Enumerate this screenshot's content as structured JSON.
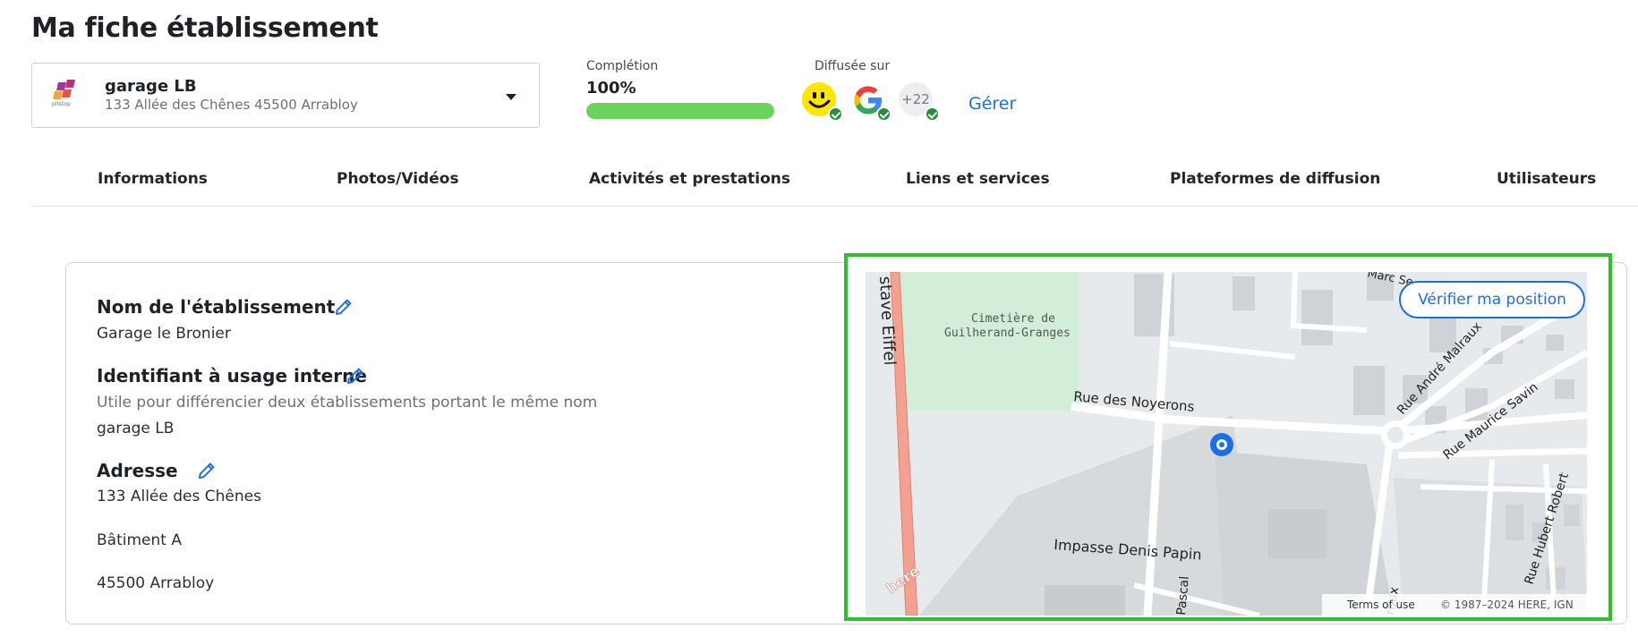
{
  "page": {
    "title": "Ma fiche établissement"
  },
  "establishment": {
    "name": "garage LB",
    "address": "133 Allée des Chênes 45500 Arrabloy",
    "logo_text": "pitstop"
  },
  "completion": {
    "label": "Complétion",
    "value_text": "100%",
    "value": 1.0,
    "color": "#6bd45b"
  },
  "diffusion": {
    "label": "Diffusée sur",
    "platforms": [
      {
        "icon": "pagesjaunes-smiley-icon"
      },
      {
        "icon": "google-g-icon"
      },
      {
        "icon": "more-platforms-badge",
        "text": "+22"
      }
    ],
    "manage_label": "Gérer"
  },
  "tabs": [
    {
      "label": "Informations"
    },
    {
      "label": "Photos/Vidéos"
    },
    {
      "label": "Activités et prestations"
    },
    {
      "label": "Liens et services"
    },
    {
      "label": "Plateformes de diffusion"
    },
    {
      "label": "Utilisateurs"
    }
  ],
  "fields": {
    "name": {
      "label": "Nom de l'établissement",
      "value": "Garage le Bronier"
    },
    "internal_id": {
      "label": "Identifiant à usage interne",
      "help": "Utile pour différencier deux établissements portant le même nom",
      "value": "garage LB"
    },
    "address": {
      "label": "Adresse",
      "line1": "133 Allée des Chênes",
      "line2": "Bâtiment A",
      "line3": "45500 Arrabloy"
    }
  },
  "map": {
    "verify_label": "Vérifier ma position",
    "streets": {
      "eiffel": "stave Eiffel",
      "cemetery_1": "Cimetière de",
      "cemetery_2": "Guilherand-Granges",
      "noyerons": "Rue des Noyerons",
      "denis_papin": "Impasse Denis Papin",
      "malraux": "Rue André Malraux",
      "savin": "Rue Maurice Savin",
      "hubert": "Rue Hubert Robert",
      "marc": "Marc Se",
      "pascal": "Pascal",
      "raux": "raux"
    },
    "watermark": "here",
    "terms": "Terms of use",
    "copyright": "© 1987–2024 HERE, IGN"
  },
  "colors": {
    "accent": "#1a6fe8",
    "highlight_border": "#2ec12e",
    "check": "#23913a"
  }
}
